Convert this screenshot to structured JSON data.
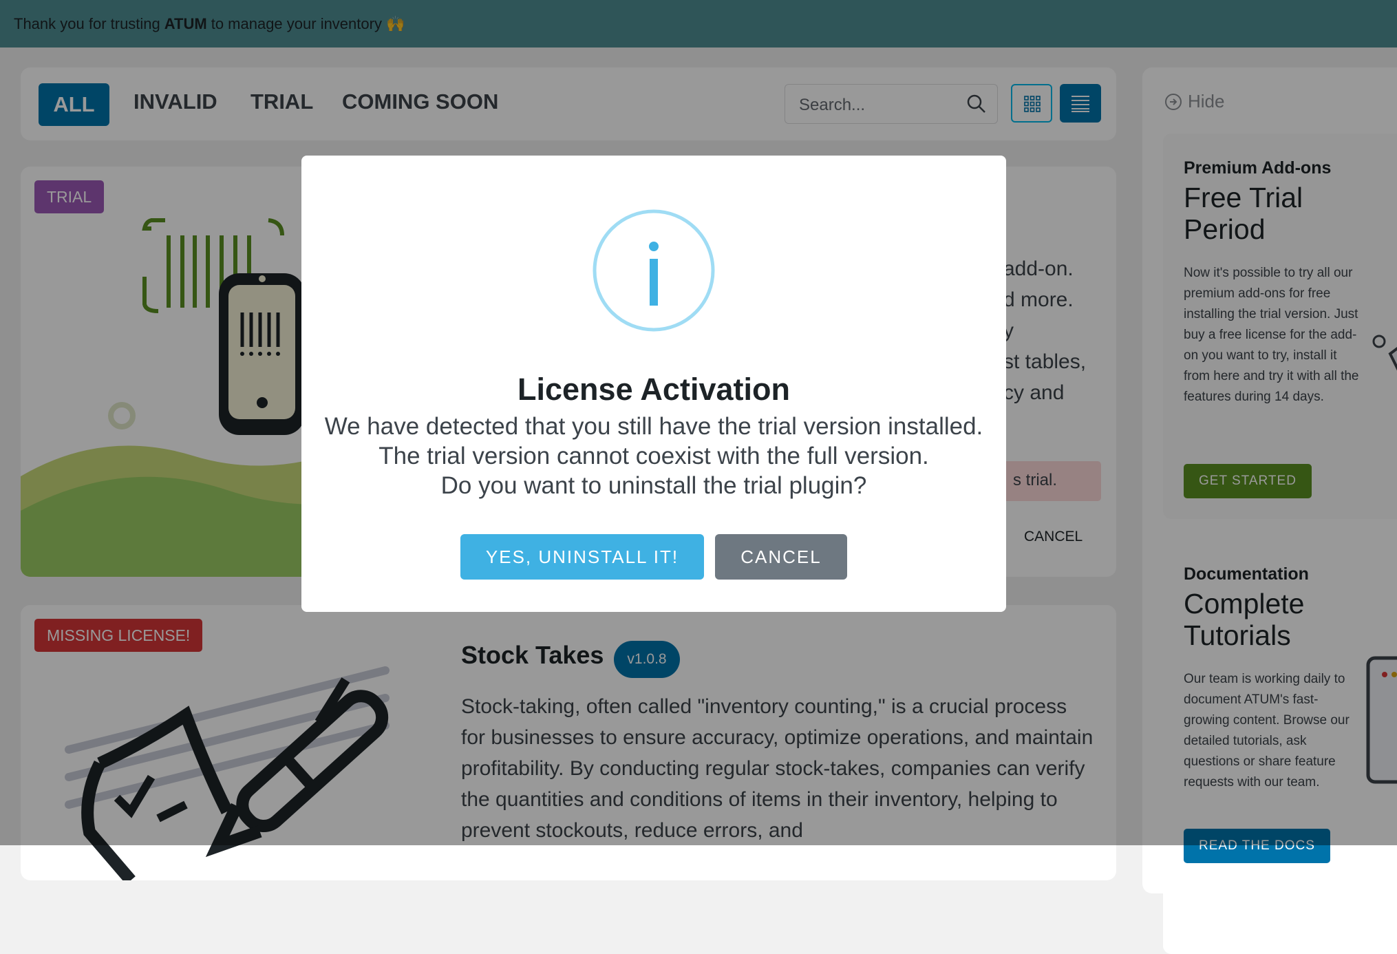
{
  "banner": {
    "pre": "Thank you for trusting",
    "brand": "ATUM",
    "post": "to manage your inventory",
    "emoji": "🙌"
  },
  "filters": {
    "all": "ALL",
    "invalid": "INVALID",
    "trial": "TRIAL",
    "coming_soon": "COMING SOON"
  },
  "search": {
    "placeholder": "Search..."
  },
  "card1": {
    "badge": "TRIAL",
    "text_lines": [
      "add-on.",
      "d more.",
      "y",
      "st tables,",
      "cy and"
    ],
    "notice": "s trial.",
    "cancel": "CANCEL"
  },
  "card2": {
    "badge": "MISSING LICENSE!",
    "title": "Stock Takes",
    "version": "v1.0.8",
    "description": "Stock-taking, often called \"inventory counting,\" is a crucial process for businesses to ensure accuracy, optimize operations, and maintain profitability. By conducting regular stock-takes, companies can verify the quantities and conditions of items in their inventory, helping to prevent stockouts, reduce errors, and"
  },
  "sidebar": {
    "hide": "Hide",
    "promo1": {
      "kicker": "Premium Add-ons",
      "title": "Free Trial Period",
      "text": "Now it's possible to try all our premium add-ons for free installing the trial version. Just buy a free license for the add-on you want to try, install it from here and try it with all the features during 14 days.",
      "button": "GET STARTED"
    },
    "promo2": {
      "kicker": "Documentation",
      "title": "Complete Tutorials",
      "text": "Our team is working daily to document ATUM's fast-growing content. Browse our detailed tutorials, ask questions or share feature requests with our team.",
      "button": "READ THE DOCS"
    }
  },
  "modal": {
    "icon": "info-icon",
    "title": "License Activation",
    "line1": "We have detected that you still have the trial version installed.",
    "line2": "The trial version cannot coexist with the full version.",
    "line3": "Do you want to uninstall the trial plugin?",
    "confirm": "YES, UNINSTALL IT!",
    "cancel": "CANCEL"
  },
  "colors": {
    "primary": "#0073aa",
    "info": "#3fb1e3",
    "cancel": "#6e7881",
    "banner": "#4f8e93"
  }
}
